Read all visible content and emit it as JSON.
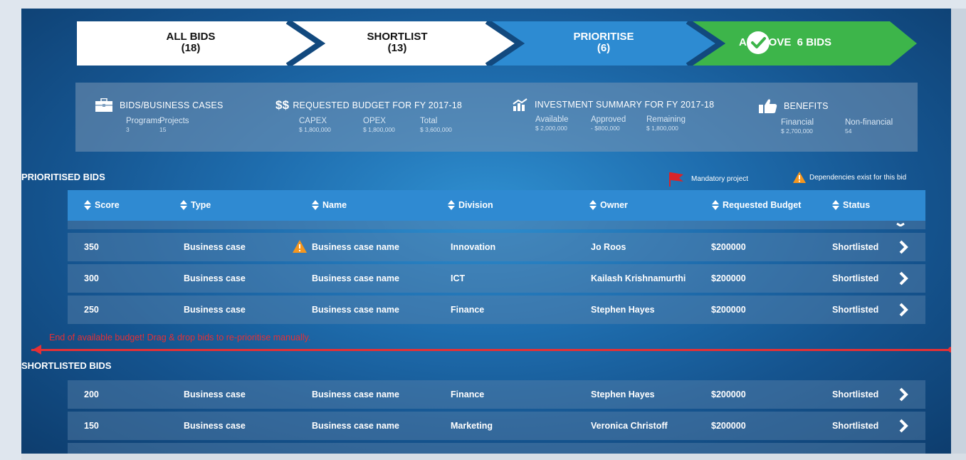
{
  "steps": [
    {
      "title": "ALL BIDS",
      "count": "(18)"
    },
    {
      "title": "SHORTLIST",
      "count": "(13)"
    },
    {
      "title": "PRIORITISE",
      "count": "(6)"
    },
    {
      "title": "APPROVE  6 BIDS"
    }
  ],
  "summary": {
    "bids": {
      "icon": "briefcase-icon",
      "title": "BIDS/BUSINESS CASES",
      "items": [
        {
          "label": "Programs",
          "value": "3"
        },
        {
          "label": "Projects",
          "value": "15"
        }
      ]
    },
    "budget": {
      "icon": "dollar-icon",
      "icon_text": "$$",
      "title": "REQUESTED BUDGET FOR FY 2017-18",
      "items": [
        {
          "label": "CAPEX",
          "value": "$ 1,800,000"
        },
        {
          "label": "OPEX",
          "value": "$ 1,800,000"
        },
        {
          "label": "Total",
          "value": "$ 3,600,000"
        }
      ]
    },
    "investment": {
      "icon": "chart-icon",
      "title": "INVESTMENT SUMMARY FOR FY 2017-18",
      "items": [
        {
          "label": "Available",
          "value": "$ 2,000,000"
        },
        {
          "label": "Approved",
          "value": "- $800,000"
        },
        {
          "label": "Remaining",
          "value": "$ 1,800,000"
        }
      ]
    },
    "benefits": {
      "icon": "thumbs-up-icon",
      "title": "BENEFITS",
      "items": [
        {
          "label": "Financial",
          "value": "$ 2,700,000"
        },
        {
          "label": "Non-financial",
          "value": "54"
        }
      ]
    }
  },
  "prioritised_title": "PRIORITISED BIDS",
  "legend": {
    "mandatory": "Mandatory project",
    "dependencies": "Dependencies exist for this bid"
  },
  "columns": [
    "Score",
    "Type",
    "Name",
    "Division",
    "Owner",
    "Requested Budget",
    "Status"
  ],
  "prioritised_rows": [
    {
      "score": "350",
      "type": "Business case",
      "name": "Business case name",
      "division": "Innovation",
      "owner": "Jo Roos",
      "budget": "$200000",
      "status": "Shortlisted",
      "warning": true
    },
    {
      "score": "300",
      "type": "Business case",
      "name": "Business case name",
      "division": "ICT",
      "owner": "Kailash Krishnamurthi",
      "budget": "$200000",
      "status": "Shortlisted"
    },
    {
      "score": "250",
      "type": "Business case",
      "name": "Business case name",
      "division": "Finance",
      "owner": "Stephen Hayes",
      "budget": "$200000",
      "status": "Shortlisted"
    }
  ],
  "budget_warning": "End of available budget! Drag & drop bids to re-prioritise manually.",
  "shortlisted_title": "SHORTLISTED BIDS",
  "shortlisted_rows": [
    {
      "score": "200",
      "type": "Business case",
      "name": "Business case name",
      "division": "Finance",
      "owner": "Stephen Hayes",
      "budget": "$200000",
      "status": "Shortlisted"
    },
    {
      "score": "150",
      "type": "Business case",
      "name": "Business case name",
      "division": "Marketing",
      "owner": "Veronica Christoff",
      "budget": "$200000",
      "status": "Shortlisted"
    }
  ],
  "colors": {
    "approve": "#3db54a",
    "prioritise": "#2d8bd2",
    "warning": "#e53035",
    "dependency": "#f5961e"
  }
}
